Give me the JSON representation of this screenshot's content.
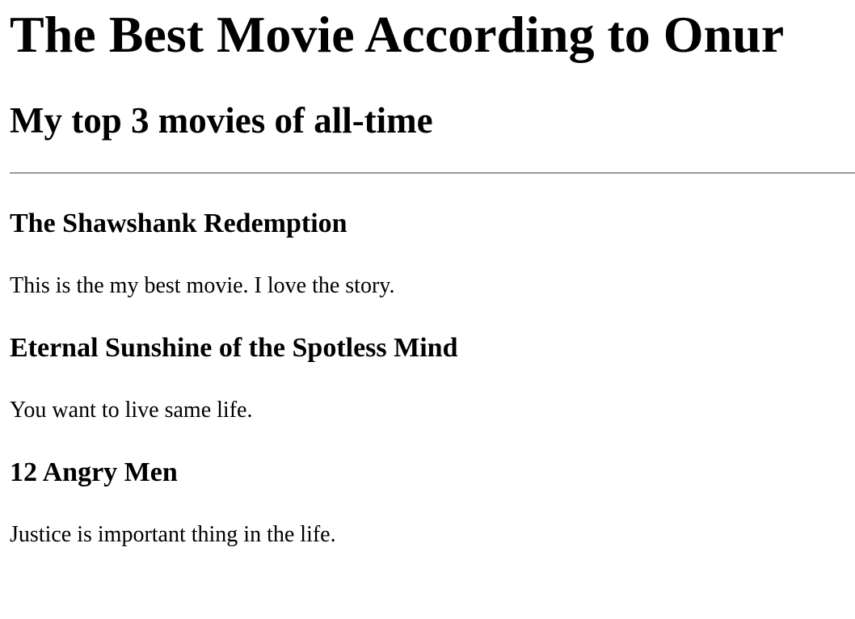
{
  "page": {
    "title": "The Best Movie According to Onur",
    "subtitle": "My top 3 movies of all-time"
  },
  "movies": [
    {
      "title": "The Shawshank Redemption",
      "description": "This is the my best movie. I love the story."
    },
    {
      "title": "Eternal Sunshine of the Spotless Mind",
      "description": "You want to live same life."
    },
    {
      "title": "12 Angry Men",
      "description": "Justice is important thing in the life."
    }
  ]
}
